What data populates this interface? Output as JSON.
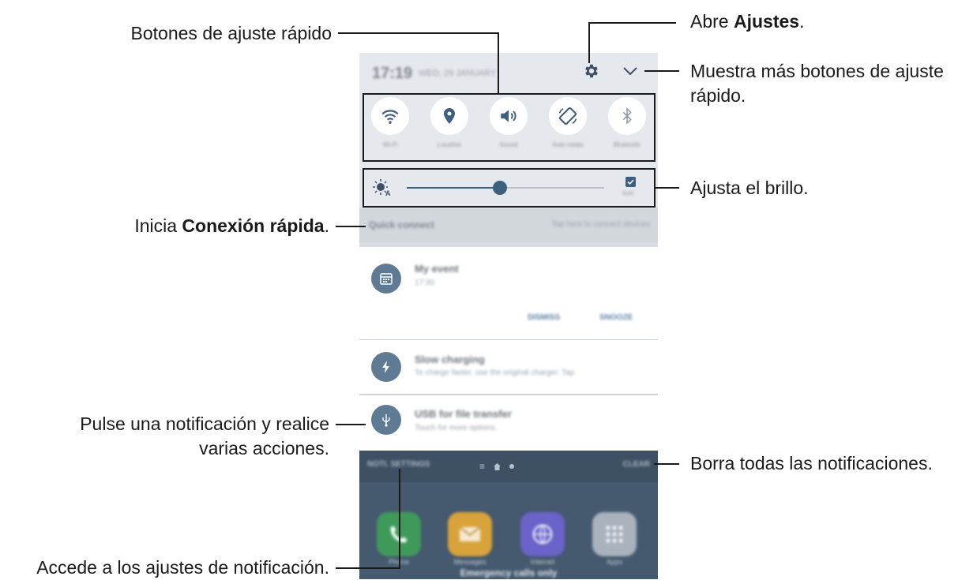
{
  "annotations": {
    "quick_buttons": "Botones de ajuste rápido",
    "open_settings_prefix": "Abre ",
    "open_settings_bold": "Ajustes",
    "open_settings_suffix": ".",
    "more_buttons_line1": "Muestra más botones de ajuste",
    "more_buttons_line2": "rápido.",
    "brightness": "Ajusta el brillo.",
    "quick_connect_prefix": "Inicia ",
    "quick_connect_bold": "Conexión rápida",
    "quick_connect_suffix": ".",
    "tap_notification_line1": "Pulse una notificación y realice",
    "tap_notification_line2": "varias acciones.",
    "clear_all": "Borra todas las notificaciones.",
    "notification_settings": "Accede a los ajustes de notificación."
  },
  "status_bar": {
    "time": "17:19",
    "date": "WED, 29 JANUARY"
  },
  "quick_settings": [
    {
      "label": "Wi-Fi",
      "icon": "wifi-icon"
    },
    {
      "label": "Location",
      "icon": "location-icon"
    },
    {
      "label": "Sound",
      "icon": "sound-icon"
    },
    {
      "label": "Auto rotate",
      "icon": "rotate-icon"
    },
    {
      "label": "Bluetooth",
      "icon": "bluetooth-icon"
    }
  ],
  "brightness": {
    "level": 0.47,
    "auto_label": "Auto",
    "auto_checked": true
  },
  "quick_connect": {
    "title": "Quick connect",
    "hint": "Tap here to connect devices"
  },
  "notifications": [
    {
      "title": "My event",
      "subtitle": "17:30",
      "icon": "calendar-icon",
      "actions": [
        "DISMISS",
        "SNOOZE"
      ]
    },
    {
      "title": "Slow charging",
      "subtitle": "To charge faster, use the original charger. Tap",
      "icon": "bolt-icon"
    },
    {
      "title": "USB for file transfer",
      "subtitle": "Touch for more options.",
      "icon": "usb-icon"
    }
  ],
  "bottom_bar": {
    "settings_label": "NOTI. SETTINGS",
    "clear_label": "CLEAR"
  },
  "home_apps": [
    {
      "label": "Phone",
      "icon": "phone-icon",
      "color": "#3f9a5a"
    },
    {
      "label": "Messages",
      "icon": "envelope-icon",
      "color": "#d8a33a"
    },
    {
      "label": "Internet",
      "icon": "globe-icon",
      "color": "#6a63c9"
    },
    {
      "label": "Apps",
      "icon": "apps-grid-icon",
      "color": "#a9b2bd"
    }
  ],
  "emergency_text": "Emergency calls only",
  "colors": {
    "accent": "#3d5f80",
    "panel": "#e5e8ec",
    "notification_icon": "#5f7a93"
  }
}
